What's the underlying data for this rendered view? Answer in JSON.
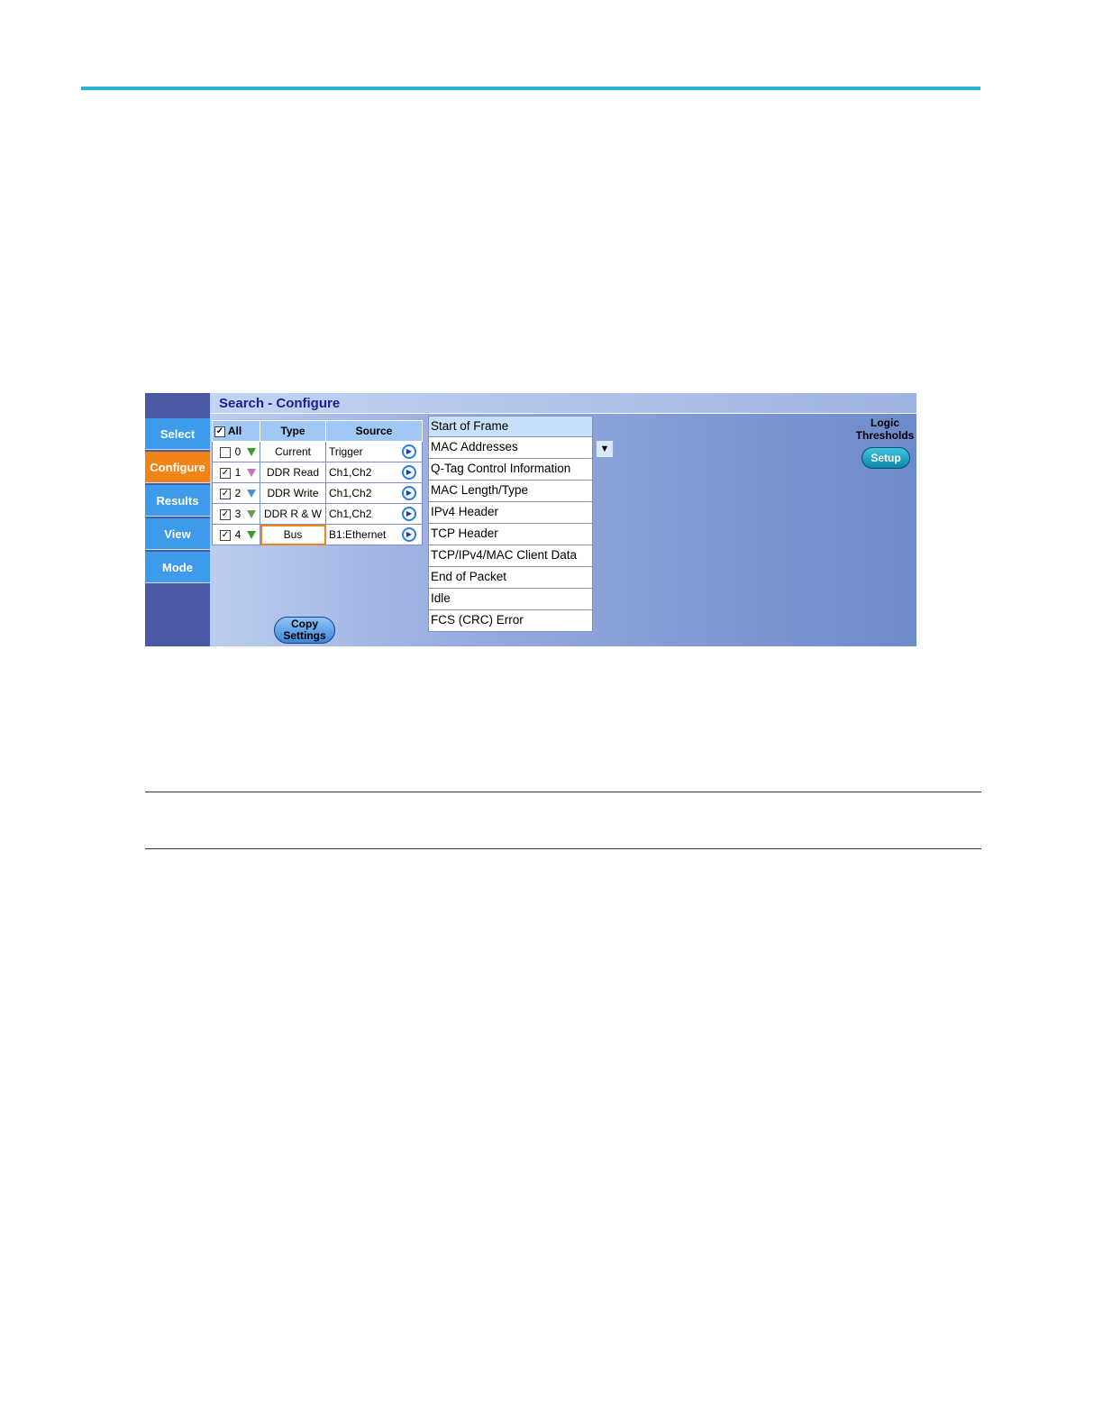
{
  "window": {
    "title": "Search - Configure"
  },
  "nav": [
    "Select",
    "Configure",
    "Results",
    "View",
    "Mode"
  ],
  "table": {
    "headers": {
      "all": "All",
      "type": "Type",
      "source": "Source"
    },
    "rows": [
      {
        "checked": "",
        "index": "0",
        "type": "Current",
        "source": "Trigger",
        "marker_color": "#3a9c2a"
      },
      {
        "checked": "✓",
        "index": "1",
        "type": "DDR Read",
        "source": "Ch1,Ch2",
        "marker_color": "#c86fc0"
      },
      {
        "checked": "✓",
        "index": "2",
        "type": "DDR Write",
        "source": "Ch1,Ch2",
        "marker_color": "#4a8fd8"
      },
      {
        "checked": "✓",
        "index": "3",
        "type": "DDR R & W",
        "source": "Ch1,Ch2",
        "marker_color": "#6aa050"
      },
      {
        "checked": "✓",
        "index": "4",
        "type": "Bus",
        "source": "B1:Ethernet",
        "marker_color": "#3a9c2a"
      }
    ],
    "all_checked": "✓"
  },
  "list": [
    "Start of Frame",
    "MAC Addresses",
    "Q-Tag Control Information",
    "MAC Length/Type",
    "IPv4 Header",
    "TCP Header",
    "TCP/IPv4/MAC Client Data",
    "End of Packet",
    "Idle",
    "FCS (CRC) Error"
  ],
  "dropdown_icon": "▼",
  "copy_settings": {
    "line1": "Copy",
    "line2": "Settings"
  },
  "logic_thresholds": {
    "line1": "Logic",
    "line2": "Thresholds",
    "setup": "Setup"
  },
  "play_icon": "▶"
}
